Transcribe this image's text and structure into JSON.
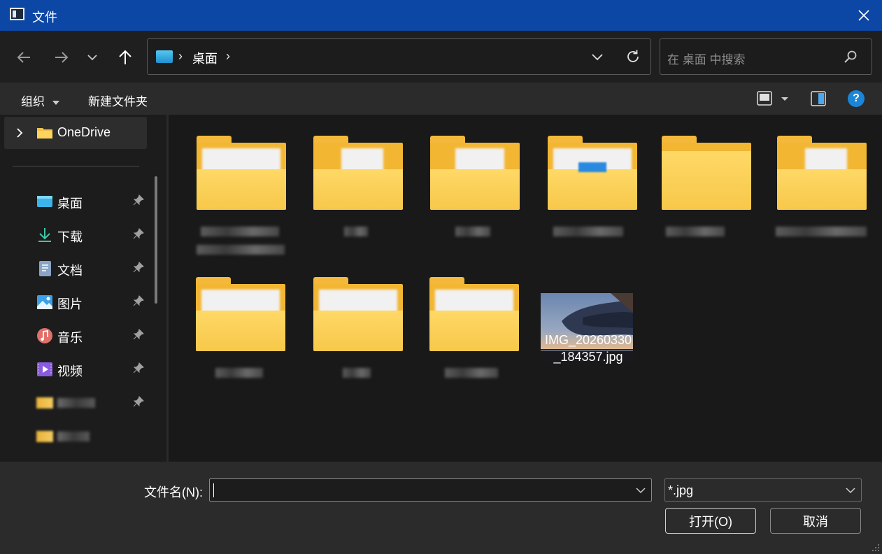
{
  "window": {
    "title": "文件",
    "icon": "window-icon",
    "close_icon": "close-icon"
  },
  "nav": {
    "back_icon": "arrow-left-icon",
    "forward_icon": "arrow-right-icon",
    "recent_icon": "chevron-down-icon",
    "up_icon": "arrow-up-icon"
  },
  "address": {
    "location_icon": "desktop-icon",
    "separator": "›",
    "location": "桌面",
    "dropdown_icon": "chevron-down-icon",
    "refresh_icon": "refresh-icon"
  },
  "search": {
    "placeholder": "在 桌面 中搜索",
    "icon": "search-icon"
  },
  "toolbar": {
    "organize_label": "组织",
    "new_folder_label": "新建文件夹",
    "view_icon": "view-icon",
    "preview_icon": "preview-pane-icon",
    "help_icon": "help-icon",
    "help_glyph": "?"
  },
  "sidebar": {
    "onedrive": {
      "label": "OneDrive",
      "icon": "folder-icon"
    },
    "quick_access": [
      {
        "label": "桌面",
        "icon": "desktop-icon",
        "pinned": true
      },
      {
        "label": "下载",
        "icon": "download-icon",
        "pinned": true
      },
      {
        "label": "文档",
        "icon": "document-icon",
        "pinned": true
      },
      {
        "label": "图片",
        "icon": "picture-icon",
        "pinned": true
      },
      {
        "label": "音乐",
        "icon": "music-icon",
        "pinned": true
      },
      {
        "label": "视频",
        "icon": "video-icon",
        "pinned": true
      }
    ],
    "pin_icon": "pin-icon"
  },
  "files": {
    "image_file": {
      "name": "IMG_20260330\n_184357.jpg",
      "name_line1": "IMG_20260330",
      "name_line2": "_184357.jpg"
    }
  },
  "footer": {
    "filename_label": "文件名(N):",
    "filename_value": "",
    "filter_value": "*.jpg",
    "open_label": "打开(O)",
    "cancel_label": "取消"
  }
}
